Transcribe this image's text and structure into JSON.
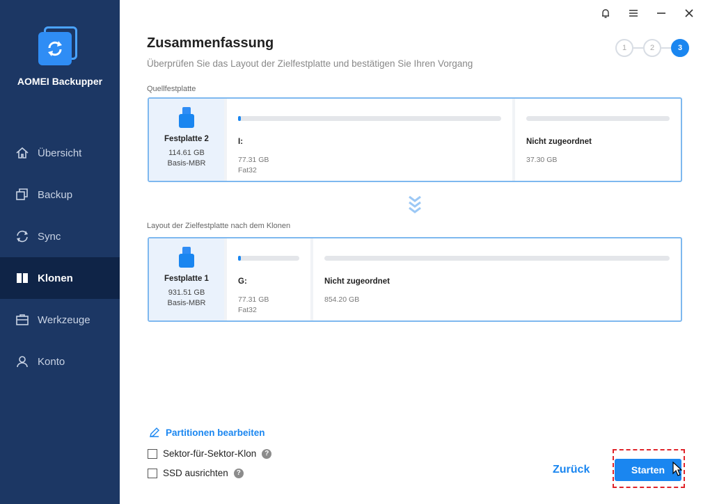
{
  "app": {
    "name": "AOMEI Backupper",
    "accent_color": "#1a86f0",
    "sidebar_color": "#1c3764"
  },
  "sidebar": {
    "items": [
      {
        "label": "Übersicht",
        "icon": "home-icon",
        "active": false
      },
      {
        "label": "Backup",
        "icon": "backup-icon",
        "active": false
      },
      {
        "label": "Sync",
        "icon": "sync-icon",
        "active": false
      },
      {
        "label": "Klonen",
        "icon": "clone-icon",
        "active": true
      },
      {
        "label": "Werkzeuge",
        "icon": "tools-icon",
        "active": false
      },
      {
        "label": "Konto",
        "icon": "user-icon",
        "active": false
      }
    ]
  },
  "window_controls": [
    "bell-icon",
    "menu-icon",
    "minimize-icon",
    "close-icon"
  ],
  "page": {
    "title": "Zusammenfassung",
    "subtitle": "Überprüfen Sie das Layout der Zielfestplatte und bestätigen Sie Ihren Vorgang",
    "steps": [
      "1",
      "2",
      "3"
    ],
    "active_step": 3
  },
  "source": {
    "label": "Quellfestplatte",
    "disk": {
      "name": "Festplatte 2",
      "size": "114.61 GB",
      "type": "Basis-MBR"
    },
    "partitions": [
      {
        "name": "I:",
        "size": "77.31 GB",
        "fs": "Fat32",
        "used_fraction": 0.01
      },
      {
        "name": "Nicht zugeordnet",
        "size": "37.30 GB",
        "fs": "",
        "used_fraction": 0
      }
    ]
  },
  "target": {
    "label": "Layout der Zielfestplatte nach dem Klonen",
    "disk": {
      "name": "Festplatte 1",
      "size": "931.51 GB",
      "type": "Basis-MBR"
    },
    "partitions": [
      {
        "name": "G:",
        "size": "77.31 GB",
        "fs": "Fat32",
        "used_fraction": 0.03
      },
      {
        "name": "Nicht zugeordnet",
        "size": "854.20 GB",
        "fs": "",
        "used_fraction": 0
      }
    ]
  },
  "options": {
    "edit_partitions": "Partitionen bearbeiten",
    "sector_clone": {
      "label": "Sektor-für-Sektor-Klon",
      "checked": false
    },
    "ssd_align": {
      "label": "SSD ausrichten",
      "checked": false
    }
  },
  "buttons": {
    "back": "Zurück",
    "start": "Starten"
  }
}
